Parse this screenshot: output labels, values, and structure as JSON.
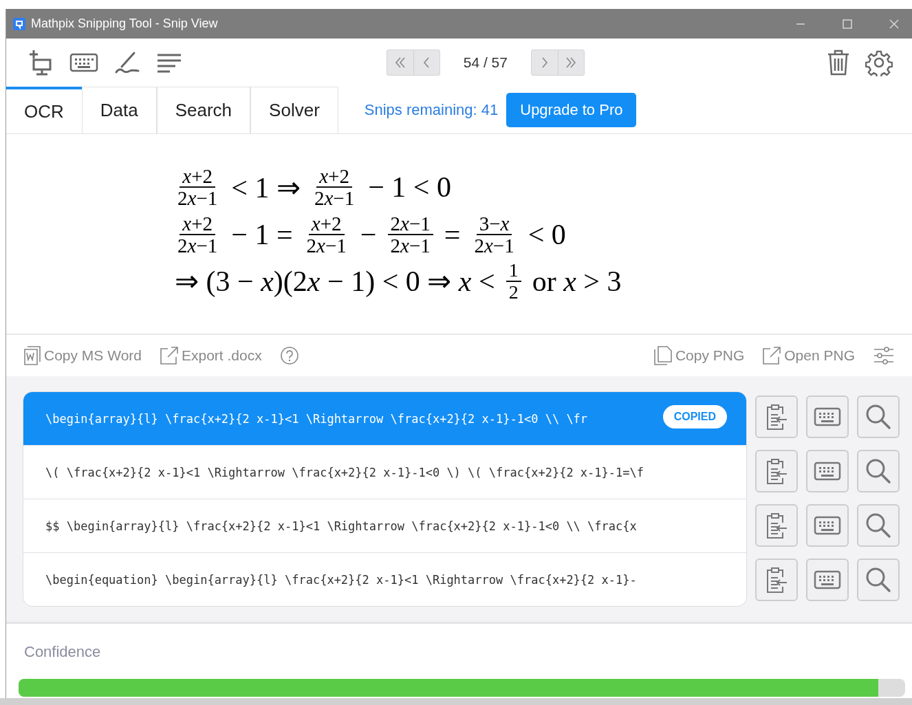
{
  "window": {
    "title": "Mathpix Snipping Tool - Snip View"
  },
  "toolbar": {
    "page_counter": "54 / 57"
  },
  "tabs": [
    {
      "label": "OCR",
      "selected": true
    },
    {
      "label": "Data",
      "selected": false
    },
    {
      "label": "Search",
      "selected": false
    },
    {
      "label": "Solver",
      "selected": false
    }
  ],
  "snips_remaining": "Snips remaining: 41",
  "upgrade_button": "Upgrade to Pro",
  "math_lines": [
    [
      {
        "kind": "frac",
        "num": "x+2",
        "den": "2x−1"
      },
      {
        "kind": "text",
        "text": "< 1 ⇒"
      },
      {
        "kind": "frac",
        "num": "x+2",
        "den": "2x−1"
      },
      {
        "kind": "text",
        "text": "− 1 < 0"
      }
    ],
    [
      {
        "kind": "frac",
        "num": "x+2",
        "den": "2x−1"
      },
      {
        "kind": "text",
        "text": "− 1 ="
      },
      {
        "kind": "frac",
        "num": "x+2",
        "den": "2x−1"
      },
      {
        "kind": "text",
        "text": "−"
      },
      {
        "kind": "frac",
        "num": "2x−1",
        "den": "2x−1"
      },
      {
        "kind": "text",
        "text": "="
      },
      {
        "kind": "frac",
        "num": "3−x",
        "den": "2x−1"
      },
      {
        "kind": "text",
        "text": "< 0"
      }
    ],
    [
      {
        "kind": "text",
        "text": "⇒ (3 − x)(2x − 1) < 0 ⇒ x <"
      },
      {
        "kind": "frac",
        "num": "1",
        "den": "2"
      },
      {
        "kind": "text",
        "text": "or x > 3"
      }
    ]
  ],
  "actions_left": [
    {
      "kind": "word",
      "label": "Copy MS Word"
    },
    {
      "kind": "export",
      "label": "Export .docx"
    },
    {
      "kind": "help"
    }
  ],
  "actions_right": [
    {
      "kind": "copy",
      "label": "Copy PNG"
    },
    {
      "kind": "export",
      "label": "Open PNG"
    },
    {
      "kind": "settings"
    }
  ],
  "formats": [
    {
      "code": "\\begin{array}{l} \\frac{x+2}{2 x-1}<1 \\Rightarrow \\frac{x+2}{2 x-1}-1<0 \\\\ \\fr",
      "selected": true,
      "badge": "COPIED"
    },
    {
      "code": "\\( \\frac{x+2}{2 x-1}<1 \\Rightarrow \\frac{x+2}{2 x-1}-1<0 \\) \\( \\frac{x+2}{2 x-1}-1=\\f",
      "selected": false
    },
    {
      "code": "$$  \\begin{array}{l} \\frac{x+2}{2 x-1}<1 \\Rightarrow \\frac{x+2}{2 x-1}-1<0 \\\\ \\frac{x",
      "selected": false
    },
    {
      "code": "\\begin{equation}  \\begin{array}{l} \\frac{x+2}{2 x-1}<1 \\Rightarrow \\frac{x+2}{2 x-1}-",
      "selected": false
    }
  ],
  "confidence": {
    "label": "Confidence",
    "level": 0.97
  }
}
